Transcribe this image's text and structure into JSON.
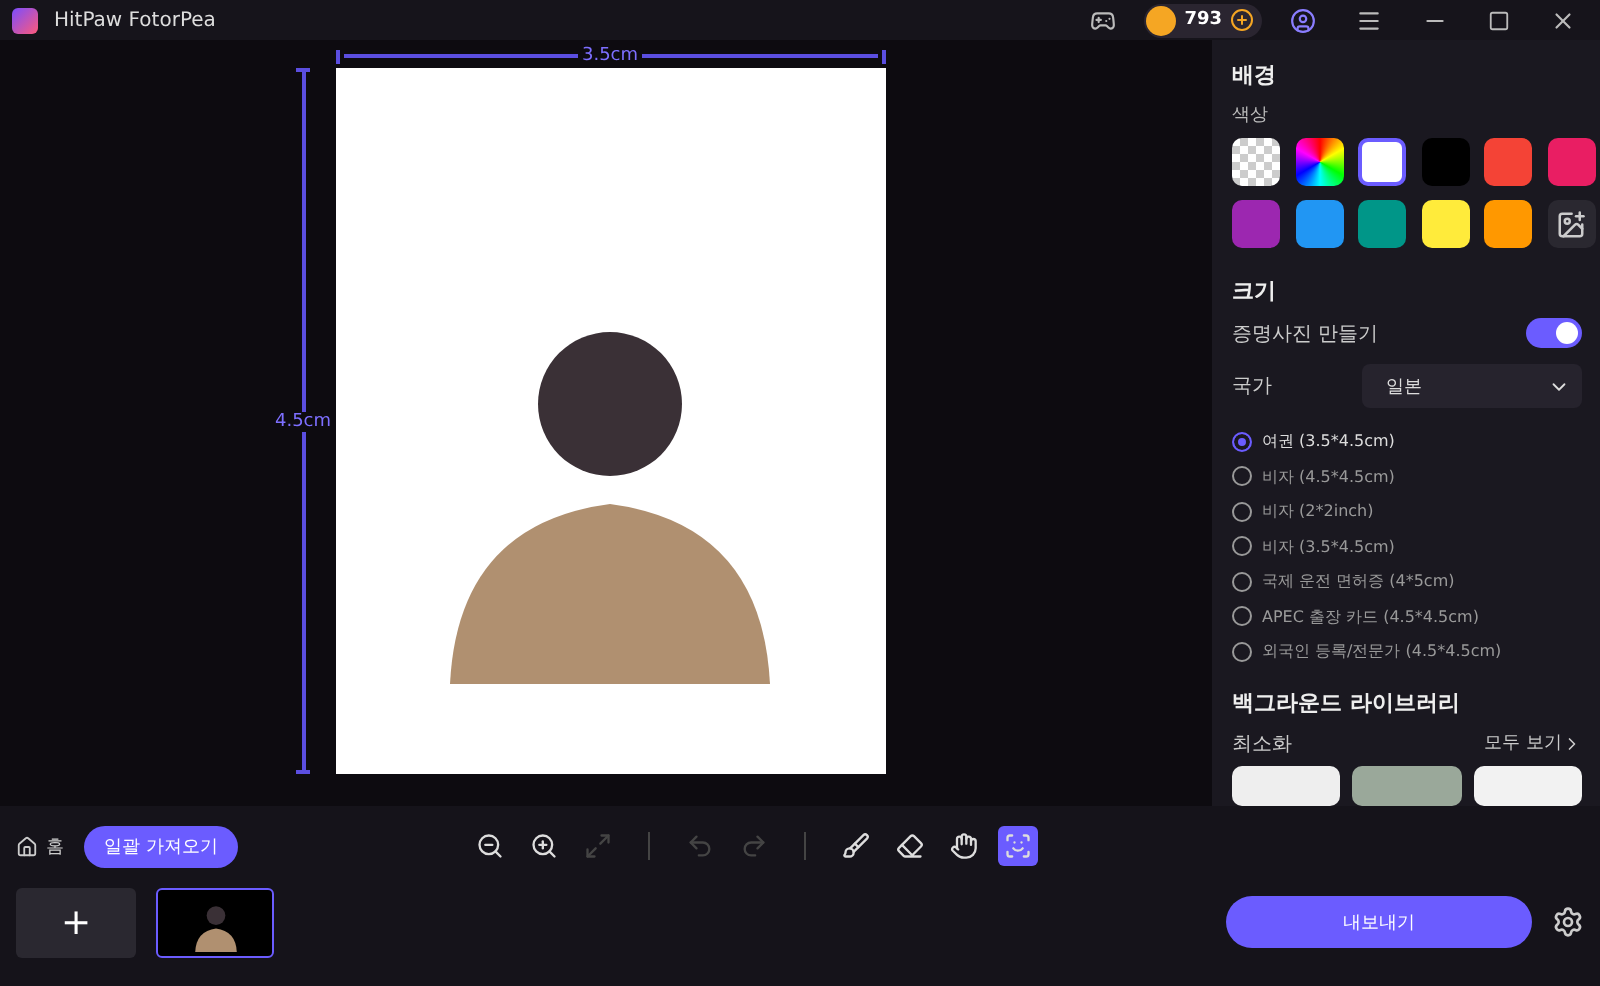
{
  "window": {
    "title": "HitPaw FotorPea",
    "coins": "793"
  },
  "canvas": {
    "width_label": "3.5cm",
    "height_label": "4.5cm"
  },
  "background": {
    "title": "배경",
    "color_label": "색상",
    "swatches": [
      {
        "kind": "transparent",
        "selected": false
      },
      {
        "kind": "rainbow",
        "selected": false
      },
      {
        "kind": "color",
        "color": "#ffffff",
        "selected": true
      },
      {
        "kind": "color",
        "color": "#000000",
        "selected": false
      },
      {
        "kind": "color",
        "color": "#f44336",
        "selected": false
      },
      {
        "kind": "color",
        "color": "#e91e63",
        "selected": false
      },
      {
        "kind": "color",
        "color": "#9c27b0",
        "selected": false
      },
      {
        "kind": "color",
        "color": "#2196f3",
        "selected": false
      },
      {
        "kind": "color",
        "color": "#009688",
        "selected": false
      },
      {
        "kind": "color",
        "color": "#ffeb3b",
        "selected": false
      },
      {
        "kind": "color",
        "color": "#ff9800",
        "selected": false
      },
      {
        "kind": "upload",
        "selected": false
      }
    ]
  },
  "size": {
    "title": "크기",
    "toggle_label": "증명사진 만들기",
    "toggle_on": true,
    "country_label": "국가",
    "country": "일본",
    "options": [
      {
        "label": "여권 (3.5*4.5cm)",
        "selected": true
      },
      {
        "label": "비자 (4.5*4.5cm)",
        "selected": false
      },
      {
        "label": "비자 (2*2inch)",
        "selected": false
      },
      {
        "label": "비자 (3.5*4.5cm)",
        "selected": false
      },
      {
        "label": "국제 운전 면허증 (4*5cm)",
        "selected": false
      },
      {
        "label": "APEC 출장 카드 (4.5*4.5cm)",
        "selected": false
      },
      {
        "label": "외국인 등록/전문가 (4.5*4.5cm)",
        "selected": false
      }
    ]
  },
  "library": {
    "title": "백그라운드 라이브러리",
    "subtitle": "최소화",
    "link": "모두 보기"
  },
  "bottom": {
    "home": "홈",
    "batch_import": "일괄 가져오기",
    "export": "내보내기",
    "tools": [
      {
        "kind": "zoom-out",
        "disabled": false,
        "selected": false
      },
      {
        "kind": "zoom-in",
        "disabled": false,
        "selected": false
      },
      {
        "kind": "fit",
        "disabled": true,
        "selected": false
      },
      {
        "kind": "sep"
      },
      {
        "kind": "undo",
        "disabled": true,
        "selected": false
      },
      {
        "kind": "redo",
        "disabled": true,
        "selected": false
      },
      {
        "kind": "sep"
      },
      {
        "kind": "brush",
        "disabled": false,
        "selected": false
      },
      {
        "kind": "eraser",
        "disabled": false,
        "selected": false
      },
      {
        "kind": "hand",
        "disabled": false,
        "selected": false
      },
      {
        "kind": "id-photo",
        "disabled": false,
        "selected": true
      }
    ],
    "add": "+",
    "thumbnails": [
      {
        "selected": true
      }
    ]
  }
}
